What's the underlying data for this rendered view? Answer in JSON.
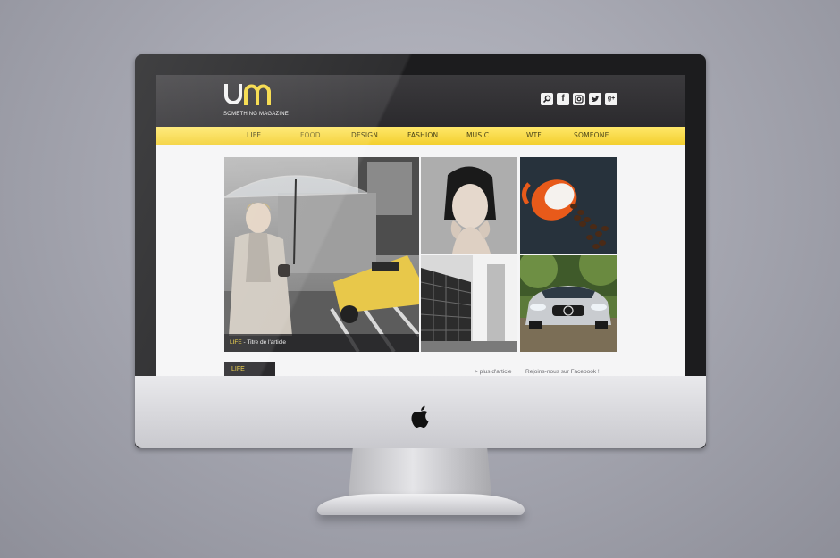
{
  "site": {
    "logo_text": "SOMETHING MAGAZINE",
    "accent_color": "#f6d93e",
    "header_color": "#2e2d30"
  },
  "social": [
    {
      "icon": "search-icon"
    },
    {
      "icon": "facebook-icon",
      "glyph": "f"
    },
    {
      "icon": "instagram-icon"
    },
    {
      "icon": "twitter-icon"
    },
    {
      "icon": "googleplus-icon",
      "glyph": "g+"
    }
  ],
  "nav": {
    "items": [
      "LIFE",
      "FOOD",
      "DESIGN",
      "FASHION",
      "MUSIC",
      "WTF",
      "SOMEONE"
    ],
    "active": "FOOD"
  },
  "featured": {
    "category": "LIFE",
    "separator": " - ",
    "title": "Titre de l'article"
  },
  "tiles": [
    {
      "subject": "woman-with-umbrella-street"
    },
    {
      "subject": "portrait-woman"
    },
    {
      "subject": "coffee-cup-beans"
    },
    {
      "subject": "building-architecture"
    },
    {
      "subject": "silver-car"
    }
  ],
  "section": {
    "label": "LIFE",
    "more_link": "> plus d'article",
    "facebook_link": "Rejoins-nous sur Facebook !"
  }
}
